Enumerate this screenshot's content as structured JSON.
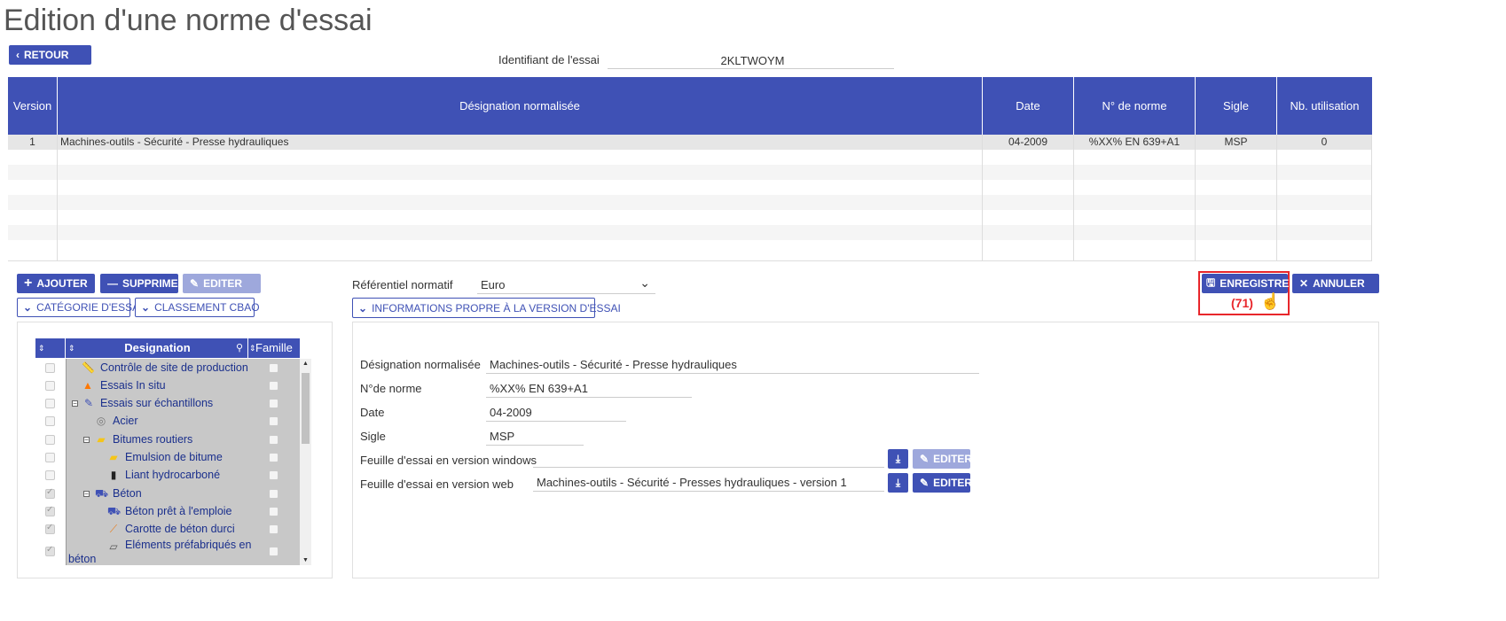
{
  "page": {
    "title": "Edition d'une norme d'essai"
  },
  "toolbar": {
    "back_label": "RETOUR"
  },
  "identifier": {
    "label": "Identifiant de l'essai",
    "value": "2KLTWOYM"
  },
  "versions_table": {
    "columns": [
      "Version",
      "Désignation normalisée",
      "Date",
      "N° de norme",
      "Sigle",
      "Nb. utilisation"
    ],
    "rows": [
      {
        "version": "1",
        "designation": "Machines-outils - Sécurité - Presse hydrauliques",
        "date": "04-2009",
        "norme": "%XX% EN 639+A1",
        "sigle": "MSP",
        "nb": "0"
      }
    ]
  },
  "left_actions": {
    "add": "AJOUTER",
    "delete": "SUPPRIMER",
    "edit": "EDITER",
    "categorie": "CATÉGORIE D'ESSAI",
    "classement": "CLASSEMENT CBAO"
  },
  "referentiel": {
    "label": "Référentiel normatif",
    "value": "Euro"
  },
  "info_toggle": "INFORMATIONS PROPRE À LA VERSION D'ESSAI",
  "right_actions": {
    "save": "ENREGISTRER",
    "cancel": "ANNULER",
    "annotation": "(71)"
  },
  "tree": {
    "columns": {
      "designation": "Designation",
      "famille": "Famille"
    },
    "items": [
      {
        "label": "Contrôle de site de production",
        "icon": "ruler-icon",
        "checked": false
      },
      {
        "label": "Essais In situ",
        "icon": "cone-icon",
        "checked": false
      },
      {
        "label": "Essais sur échantillons",
        "icon": "pipette-icon",
        "checked": false
      },
      {
        "label": "Acier",
        "icon": "steel-coil-icon",
        "checked": false
      },
      {
        "label": "Bitumes routiers",
        "icon": "folder-open-icon",
        "checked": false
      },
      {
        "label": "Emulsion de bitume",
        "icon": "folder-icon",
        "checked": false
      },
      {
        "label": "Liant hydrocarboné",
        "icon": "barrel-icon",
        "checked": false
      },
      {
        "label": "Béton",
        "icon": "concrete-truck-icon",
        "checked": true
      },
      {
        "label": "Béton prêt à l'emploie",
        "icon": "concrete-truck-icon",
        "checked": true
      },
      {
        "label": "Carotte de béton durci",
        "icon": "carrot-icon",
        "checked": true
      },
      {
        "label": "Eléments préfabriqués en",
        "label2": "béton",
        "icon": "slab-icon",
        "checked": true
      }
    ]
  },
  "form": {
    "designation": {
      "label": "Désignation normalisée",
      "value": "Machines-outils - Sécurité - Presse hydrauliques"
    },
    "norme": {
      "label": "N°de norme",
      "value": "%XX% EN 639+A1"
    },
    "date": {
      "label": "Date",
      "value": "04-2009"
    },
    "sigle": {
      "label": "Sigle",
      "value": "MSP"
    },
    "windows": {
      "label": "Feuille d'essai en version windows",
      "value": "",
      "edit": "EDITER"
    },
    "web": {
      "label": "Feuille d'essai en version web",
      "value": "Machines-outils - Sécurité - Presses hydrauliques - version 1",
      "edit": "EDITER"
    }
  },
  "colors": {
    "primary": "#3f51b5",
    "primary_disabled": "#9ea8dc",
    "highlight": "#e8262b"
  }
}
